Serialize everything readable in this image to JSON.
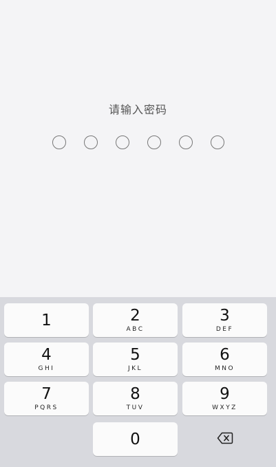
{
  "prompt": "请输入密码",
  "passcode": {
    "length": 6,
    "filled": 0
  },
  "keypad": {
    "keys": [
      {
        "num": "1",
        "letters": ""
      },
      {
        "num": "2",
        "letters": "ABC"
      },
      {
        "num": "3",
        "letters": "DEF"
      },
      {
        "num": "4",
        "letters": "GHI"
      },
      {
        "num": "5",
        "letters": "JKL"
      },
      {
        "num": "6",
        "letters": "MNO"
      },
      {
        "num": "7",
        "letters": "PQRS"
      },
      {
        "num": "8",
        "letters": "TUV"
      },
      {
        "num": "9",
        "letters": "WXYZ"
      },
      {
        "num": "0",
        "letters": ""
      }
    ],
    "delete_icon": "backspace-icon"
  }
}
